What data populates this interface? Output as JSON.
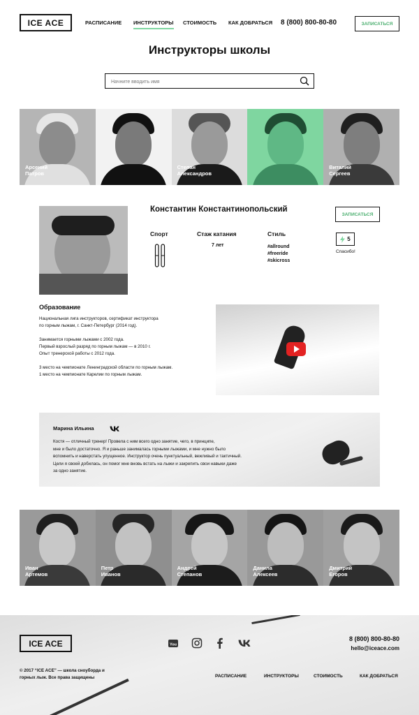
{
  "header": {
    "logo": "ICE ACE",
    "nav": [
      {
        "label": "Расписание",
        "active": false
      },
      {
        "label": "Инструкторы",
        "active": true
      },
      {
        "label": "Стоимость",
        "active": false
      },
      {
        "label": "Как добраться",
        "active": false
      }
    ],
    "phone": "8 (800) 800-80-80",
    "signup_label": "Записаться"
  },
  "page_title": "Инструкторы школы",
  "search": {
    "placeholder": "Начните вводить имя"
  },
  "instructors_top": [
    {
      "name": "Арсений\nПатров"
    },
    {
      "name": ""
    },
    {
      "name": "Степан\nАлександров"
    },
    {
      "name": ""
    },
    {
      "name": "Виталий\nСергеев"
    }
  ],
  "profile": {
    "name": "Константин Константинопольский",
    "sport_label": "Спорт",
    "experience_label": "Стаж катания",
    "experience_value": "7 лет",
    "style_label": "Стиль",
    "style_tags": [
      "#allround",
      "#freeride",
      "#skicross"
    ],
    "signup_label": "Записаться",
    "thanks_count": "5",
    "thanks_label": "Спасибо!"
  },
  "education": {
    "title": "Образование",
    "text": "Национальная лига инструкторов, сертификат инструктора\nпо горным лыжам, г. Санкт-Петербург (2014 год).\n\nЗанимается горными лыжами с 2002 года.\nПервый взрослый разряд по горным лыжам — в 2010 г.\nОпыт тренерской работы с 2012 года.\n\n3 место на чемпионате Ленинградской области по горным лыжам.\n1 место на чемпионате Карелии по горным лыжам."
  },
  "review": {
    "author": "Марина Ильина",
    "text": "Костя — отличный тренер! Провела с ним всего одно занятие, чего, в принципе,\nмне и было достаточно. Я и раньше занималась горными лыжами, и мне нужно было\nвспомнить и наверстать упущенное. Инструктор очень пунктуальный, вежливый и тактичный.\nЦели я своей добилась, он помог мне вновь встать на лыжи и закрепить свои навыки даже\nза одно занятие."
  },
  "instructors_bottom": [
    {
      "name": "Иван\nАртемов"
    },
    {
      "name": "Петр\nИванов"
    },
    {
      "name": "Андрей\nСтепанов"
    },
    {
      "name": "Данила\nАлексеев"
    },
    {
      "name": "Дмитрий\nЕгоров"
    }
  ],
  "footer": {
    "logo": "ICE ACE",
    "social_icons": [
      "youtube-icon",
      "instagram-icon",
      "facebook-icon",
      "vk-icon"
    ],
    "phone": "8 (800) 800-80-80",
    "email": "hello@iceace.com",
    "copyright": "© 2017 “ICE ACE” — школа сноуборда и\nгорных лыж. Все права защищены",
    "nav": [
      "Расписание",
      "Инструкторы",
      "Стоимость",
      "Как добраться"
    ]
  },
  "colors": {
    "accent": "#7fd6a0",
    "accent_text": "#4caf70",
    "text": "#111111"
  }
}
